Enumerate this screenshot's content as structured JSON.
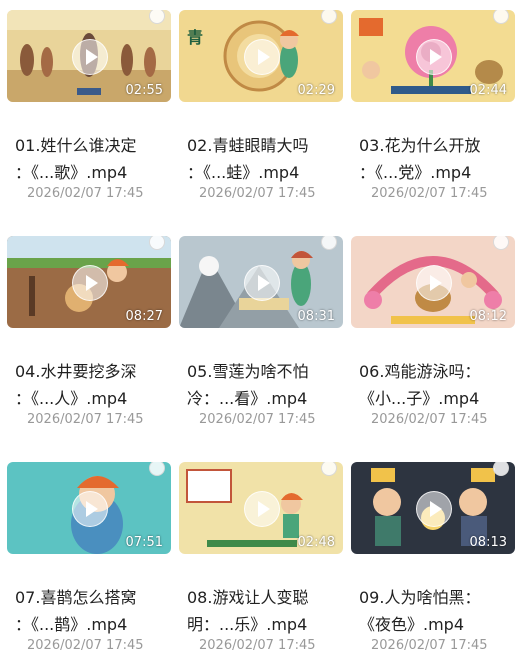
{
  "videos": [
    {
      "title_line1": "01.姓什么谁决定",
      "title_line2": "：《...歌》.mp4",
      "date": "2026/02/07 17:45",
      "duration": "02:55"
    },
    {
      "title_line1": "02.青蛙眼睛大吗",
      "title_line2": "：《...蛙》.mp4",
      "date": "2026/02/07 17:45",
      "duration": "02:29"
    },
    {
      "title_line1": "03.花为什么开放",
      "title_line2": "：《...党》.mp4",
      "date": "2026/02/07 17:45",
      "duration": "02:44"
    },
    {
      "title_line1": "04.水井要挖多深",
      "title_line2": "：《...人》.mp4",
      "date": "2026/02/07 17:45",
      "duration": "08:27"
    },
    {
      "title_line1": "05.雪莲为啥不怕",
      "title_line2": "冷：...看》.mp4",
      "date": "2026/02/07 17:45",
      "duration": "08:31"
    },
    {
      "title_line1": "06.鸡能游泳吗：",
      "title_line2": "《小...子》.mp4",
      "date": "2026/02/07 17:45",
      "duration": "08:12"
    },
    {
      "title_line1": "07.喜鹊怎么搭窝",
      "title_line2": "：《...鹊》.mp4",
      "date": "2026/02/07 17:45",
      "duration": "07:51"
    },
    {
      "title_line1": "08.游戏让人变聪",
      "title_line2": "明：...乐》.mp4",
      "date": "2026/02/07 17:45",
      "duration": "02:48"
    },
    {
      "title_line1": "09.人为啥怕黑：",
      "title_line2": "《夜色》.mp4",
      "date": "2026/02/07 17:45",
      "duration": "08:13"
    }
  ],
  "thumbnail_text": {
    "v2_char": "青"
  }
}
